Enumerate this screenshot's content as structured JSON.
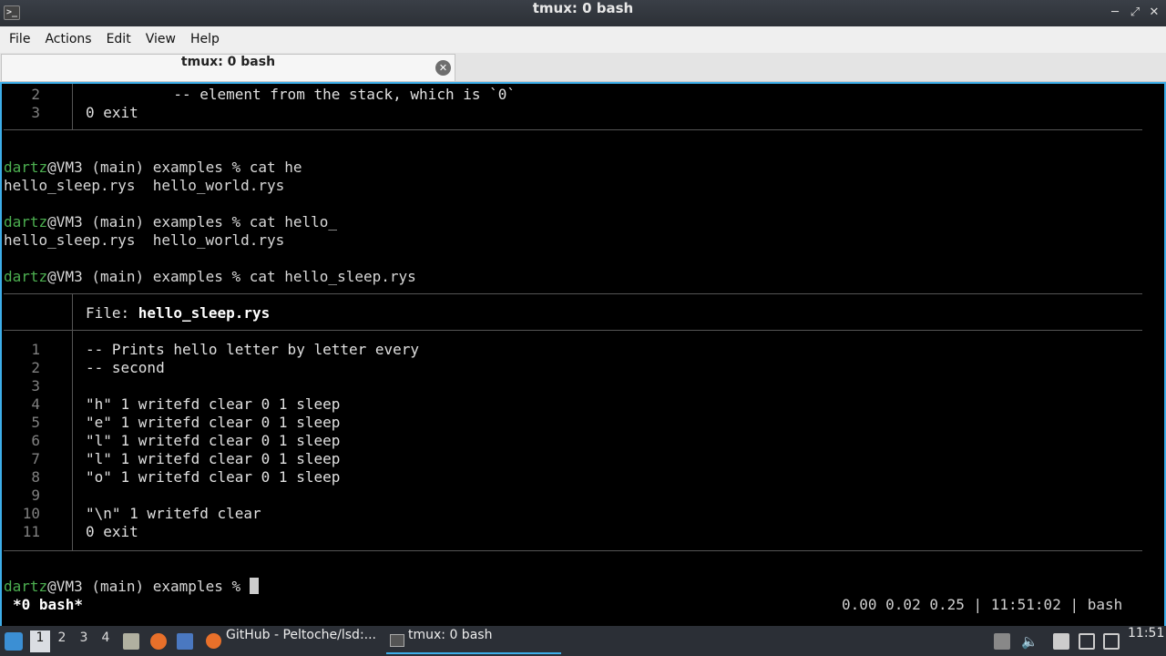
{
  "window": {
    "title": "tmux: 0 bash"
  },
  "menu": [
    "File",
    "Actions",
    "Edit",
    "View",
    "Help"
  ],
  "tab": {
    "label": "tmux: 0 bash"
  },
  "terminal": {
    "top_block": [
      {
        "num": "2",
        "code": "          -- element from the stack, which is `0`"
      },
      {
        "num": "3",
        "code": "0 exit"
      }
    ],
    "prompt_user": "dartz",
    "prompt_rest": "@VM3 (main) examples % ",
    "commands": [
      {
        "cmd": "cat he",
        "output": "hello_sleep.rys  hello_world.rys"
      },
      {
        "cmd": "cat hello_",
        "output": "hello_sleep.rys  hello_world.rys"
      },
      {
        "cmd": "cat hello_sleep.rys"
      }
    ],
    "file_header_label": "File: ",
    "file_name": "hello_sleep.rys",
    "file_lines": [
      {
        "num": "1",
        "code": "-- Prints hello letter by letter every"
      },
      {
        "num": "2",
        "code": "-- second"
      },
      {
        "num": "3",
        "code": ""
      },
      {
        "num": "4",
        "code": "\"h\" 1 writefd clear 0 1 sleep"
      },
      {
        "num": "5",
        "code": "\"e\" 1 writefd clear 0 1 sleep"
      },
      {
        "num": "6",
        "code": "\"l\" 1 writefd clear 0 1 sleep"
      },
      {
        "num": "7",
        "code": "\"l\" 1 writefd clear 0 1 sleep"
      },
      {
        "num": "8",
        "code": "\"o\" 1 writefd clear 0 1 sleep"
      },
      {
        "num": "9",
        "code": ""
      },
      {
        "num": "10",
        "code": "\"\\n\" 1 writefd clear"
      },
      {
        "num": "11",
        "code": "0 exit"
      }
    ],
    "status_left": "*0 bash*",
    "status_right": "0.00 0.02 0.25 | 11:51:02 | bash"
  },
  "taskbar": {
    "workspaces": [
      "1",
      "2",
      "3",
      "4"
    ],
    "tasks": [
      {
        "label": "GitHub - Peltoche/lsd:...",
        "icon": "firefox-icon"
      },
      {
        "label": "tmux: 0 bash",
        "icon": "terminal-icon"
      }
    ],
    "clock": "11:51"
  },
  "colors": {
    "accent": "#3daee9",
    "prompt_user": "#4caf50"
  }
}
